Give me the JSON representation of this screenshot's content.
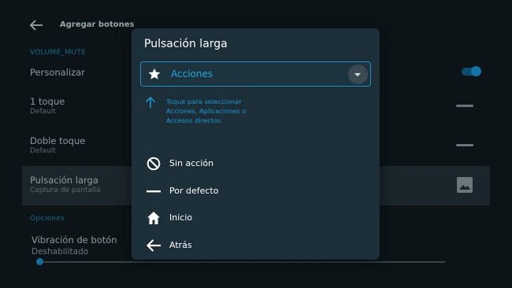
{
  "screen": {
    "title": "Agregar botones",
    "section_1": "VOLUME_MUTE",
    "section_2": "Opciones",
    "rows": [
      {
        "title": "Personalizar"
      },
      {
        "title": "1 toque",
        "subtitle": "Default"
      },
      {
        "title": "Doble toque",
        "subtitle": "Default"
      },
      {
        "title": "Pulsación larga",
        "subtitle": "Captura de pantalla"
      },
      {
        "title": "Vibración de botón",
        "subtitle": "Deshabilitado"
      }
    ],
    "toggle_on": true,
    "vibration_level": 0
  },
  "dialog": {
    "title": "Pulsación larga",
    "dropdown": {
      "selected": "Acciones",
      "icon": "star-icon"
    },
    "hint": "Toque para seleccionar Acciones, Aplicaciones o Accesos directos",
    "options": [
      {
        "label": "Sin acción",
        "icon": "block-icon"
      },
      {
        "label": "Por defecto",
        "icon": "dash-icon"
      },
      {
        "label": "Inicio",
        "icon": "home-icon"
      },
      {
        "label": "Atrás",
        "icon": "arrow-left-icon"
      }
    ]
  },
  "colors": {
    "accent": "#1a90c7",
    "dialog_bg": "#1c2f39",
    "screen_bg": "#0c1418"
  }
}
